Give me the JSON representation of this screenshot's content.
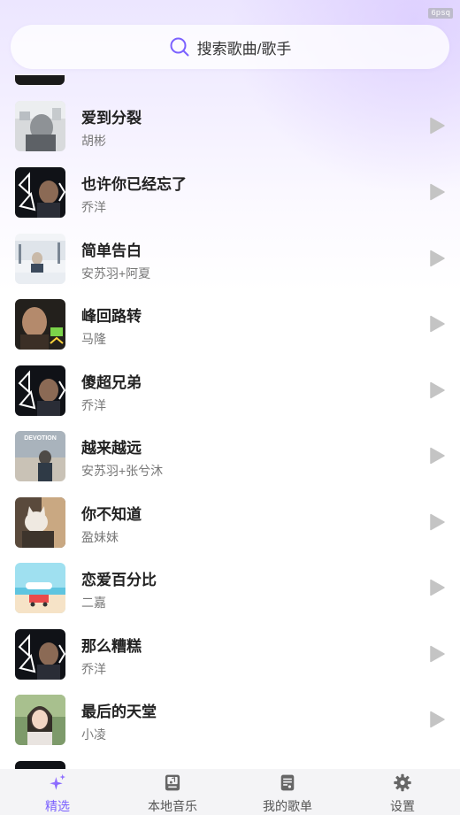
{
  "status_bar": {
    "fps": "6psq"
  },
  "search": {
    "placeholder": "搜索歌曲/歌手",
    "icon": "search-icon",
    "accent": "#7b61ff"
  },
  "songs": [
    {
      "title": "爱到分裂",
      "artist": "胡彬",
      "cover": "cover-grey-portrait"
    },
    {
      "title": "也许你已经忘了",
      "artist": "乔洋",
      "cover": "cover-qiaoyang"
    },
    {
      "title": "简单告白",
      "artist": "安苏羽+阿夏",
      "cover": "cover-snow"
    },
    {
      "title": "峰回路转",
      "artist": "马隆",
      "cover": "cover-dark-portrait"
    },
    {
      "title": "傻超兄弟",
      "artist": "乔洋",
      "cover": "cover-qiaoyang"
    },
    {
      "title": "越来越远",
      "artist": "安苏羽+张兮沐",
      "cover": "cover-devotion",
      "cover_text": "DEVOTION"
    },
    {
      "title": "你不知道",
      "artist": "盈妹妹",
      "cover": "cover-cat"
    },
    {
      "title": "恋爱百分比",
      "artist": "二嘉",
      "cover": "cover-beach"
    },
    {
      "title": "那么糟糕",
      "artist": "乔洋",
      "cover": "cover-qiaoyang"
    },
    {
      "title": "最后的天堂",
      "artist": "小凌",
      "cover": "cover-girl"
    }
  ],
  "tabs": [
    {
      "label": "精选",
      "icon": "sparkle-icon",
      "active": true
    },
    {
      "label": "本地音乐",
      "icon": "music-file-icon",
      "active": false
    },
    {
      "label": "我的歌单",
      "icon": "playlist-icon",
      "active": false
    },
    {
      "label": "设置",
      "icon": "gear-icon",
      "active": false
    }
  ],
  "colors": {
    "accent": "#7b61ff",
    "play": "#c4c4c4"
  }
}
